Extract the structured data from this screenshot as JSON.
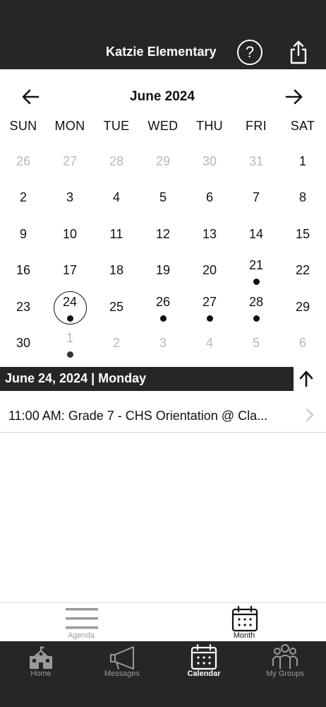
{
  "header": {
    "title": "Katzie Elementary",
    "help_icon": "question-circle-icon",
    "share_icon": "share-icon"
  },
  "calendar": {
    "month_title": "June 2024",
    "weekdays": [
      "SUN",
      "MON",
      "TUE",
      "WED",
      "THU",
      "FRI",
      "SAT"
    ],
    "weeks": [
      [
        {
          "d": "26",
          "out": true
        },
        {
          "d": "27",
          "out": true
        },
        {
          "d": "28",
          "out": true
        },
        {
          "d": "29",
          "out": true
        },
        {
          "d": "30",
          "out": true
        },
        {
          "d": "31",
          "out": true
        },
        {
          "d": "1"
        }
      ],
      [
        {
          "d": "2"
        },
        {
          "d": "3"
        },
        {
          "d": "4"
        },
        {
          "d": "5"
        },
        {
          "d": "6"
        },
        {
          "d": "7"
        },
        {
          "d": "8"
        }
      ],
      [
        {
          "d": "9"
        },
        {
          "d": "10"
        },
        {
          "d": "11"
        },
        {
          "d": "12"
        },
        {
          "d": "13"
        },
        {
          "d": "14"
        },
        {
          "d": "15"
        }
      ],
      [
        {
          "d": "16"
        },
        {
          "d": "17"
        },
        {
          "d": "18"
        },
        {
          "d": "19"
        },
        {
          "d": "20"
        },
        {
          "d": "21",
          "ev": true
        },
        {
          "d": "22"
        }
      ],
      [
        {
          "d": "23"
        },
        {
          "d": "24",
          "ev": true,
          "sel": true
        },
        {
          "d": "25"
        },
        {
          "d": "26",
          "ev": true
        },
        {
          "d": "27",
          "ev": true
        },
        {
          "d": "28",
          "ev": true
        },
        {
          "d": "29"
        }
      ],
      [
        {
          "d": "30"
        },
        {
          "d": "1",
          "out": true,
          "ev": true
        },
        {
          "d": "2",
          "out": true
        },
        {
          "d": "3",
          "out": true
        },
        {
          "d": "4",
          "out": true
        },
        {
          "d": "5",
          "out": true
        },
        {
          "d": "6",
          "out": true
        }
      ]
    ]
  },
  "selected_date": {
    "label": "June 24, 2024 | Monday"
  },
  "events": [
    {
      "text": "11:00 AM: Grade 7 - CHS Orientation @ Cla..."
    }
  ],
  "view_switcher": {
    "agenda_label": "Agenda",
    "month_label": "Month",
    "active": "Month"
  },
  "tabbar": {
    "home_label": "Home",
    "messages_label": "Messages",
    "calendar_label": "Calendar",
    "groups_label": "My Groups",
    "active": "Calendar"
  },
  "colors": {
    "header_bg": "#262626",
    "outside_day": "#b8b8b8",
    "inactive_tab": "#9a9a9a"
  }
}
